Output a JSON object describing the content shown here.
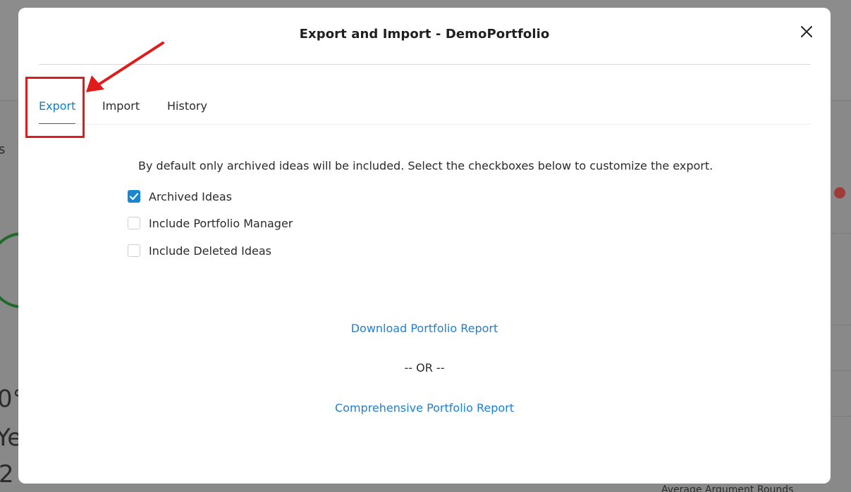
{
  "modal": {
    "title": "Export and Import - DemoPortfolio",
    "tabs": [
      {
        "label": "Export",
        "active": true
      },
      {
        "label": "Import",
        "active": false
      },
      {
        "label": "History",
        "active": false
      }
    ],
    "description": "By default only archived ideas will be included. Select the checkboxes below to customize the export.",
    "options": [
      {
        "label": "Archived Ideas",
        "checked": true
      },
      {
        "label": "Include Portfolio Manager",
        "checked": false
      },
      {
        "label": "Include Deleted Ideas",
        "checked": false
      }
    ],
    "download_link": "Download Portfolio Report",
    "separator": "-- OR --",
    "comprehensive_link": "Comprehensive Portfolio Report"
  },
  "background": {
    "fragment_s": "s",
    "fragment_0": "0°",
    "fragment_ye": "Ye",
    "fragment_2": "2",
    "footer_text": "Average Argument Rounds"
  },
  "colors": {
    "accent": "#0f7ec4",
    "link": "#1e7fd6",
    "annotation": "#e01b1b"
  },
  "icons": {
    "close": "close-icon",
    "check": "checkmark-icon"
  }
}
